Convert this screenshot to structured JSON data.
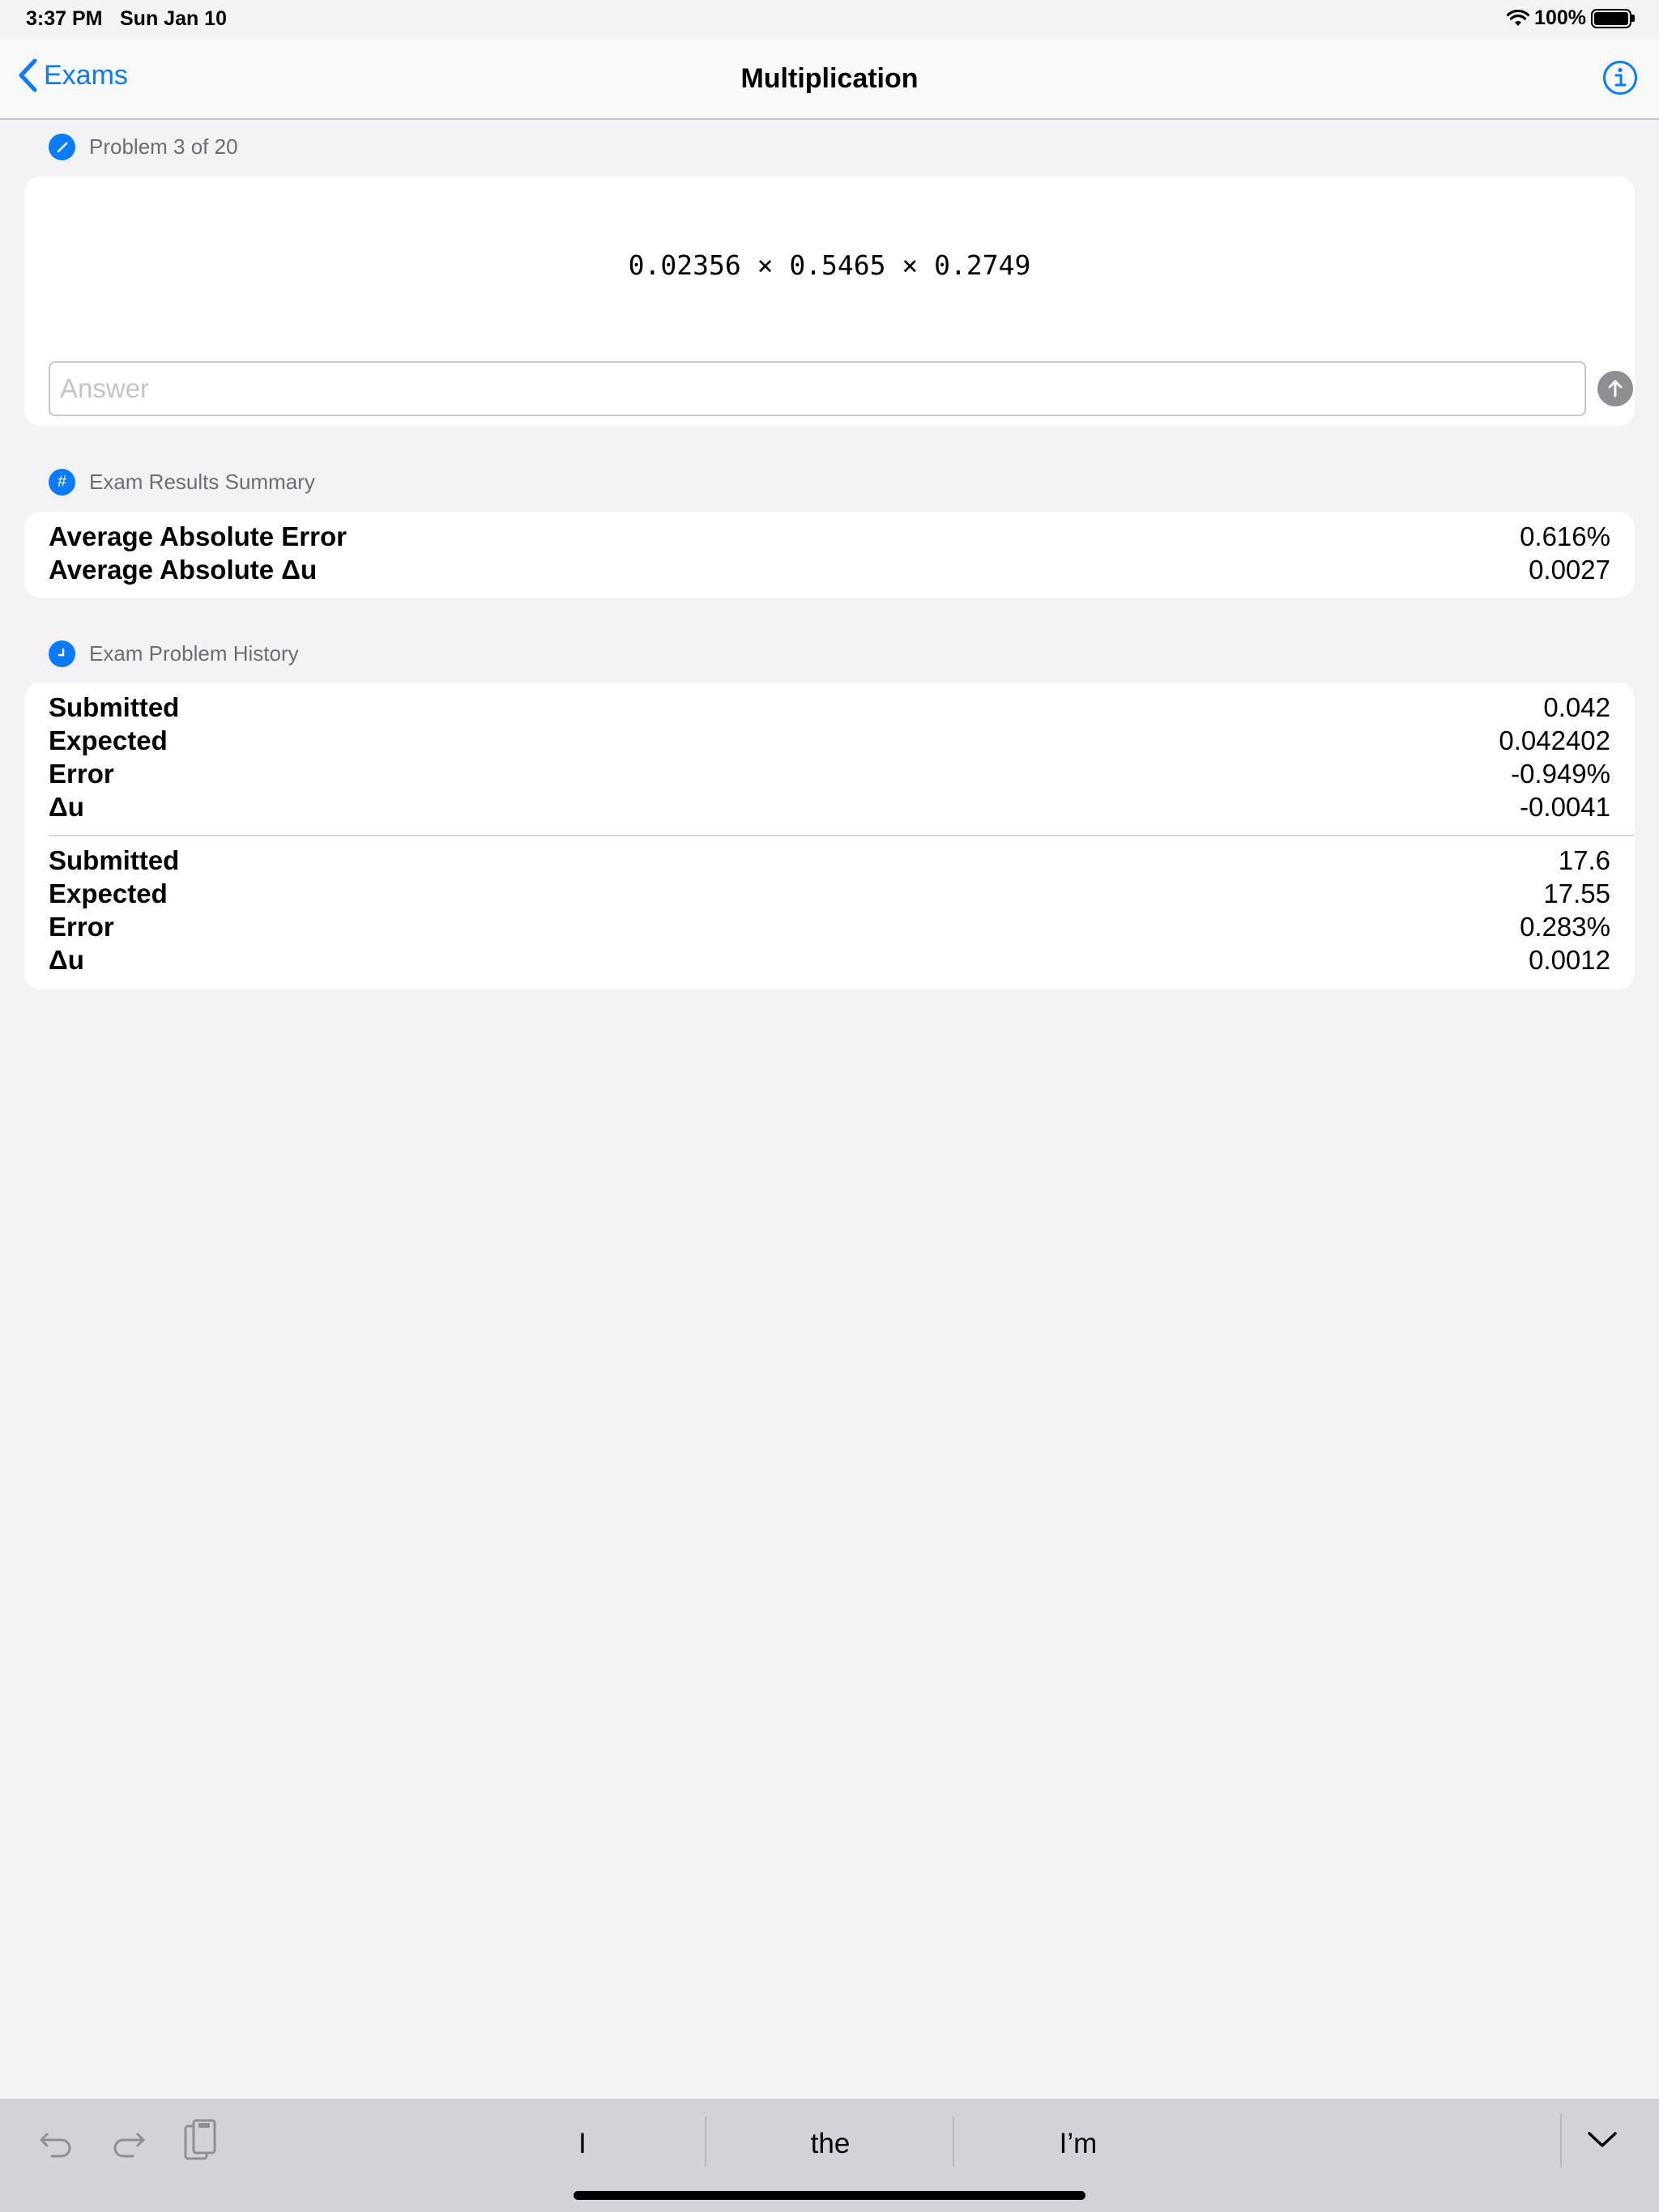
{
  "status_bar": {
    "time": "3:37 PM",
    "date": "Sun Jan 10",
    "battery": "100%"
  },
  "nav": {
    "back_label": "Exams",
    "title": "Multiplication"
  },
  "problem_section": {
    "header": "Problem 3 of 20",
    "expression": "0.02356 × 0.5465 × 0.2749",
    "answer_placeholder": "Answer",
    "answer_value": ""
  },
  "summary_section": {
    "header": "Exam Results Summary",
    "rows": [
      {
        "label": "Average Absolute Error",
        "value": "0.616%"
      },
      {
        "label": "Average Absolute Δu",
        "value": "0.0027"
      }
    ]
  },
  "history_section": {
    "header": "Exam Problem History",
    "entries": [
      {
        "submitted_label": "Submitted",
        "submitted": "0.042",
        "expected_label": "Expected",
        "expected": "0.042402",
        "error_label": "Error",
        "error": "-0.949%",
        "delta_label": "Δu",
        "delta": "-0.0041"
      },
      {
        "submitted_label": "Submitted",
        "submitted": "17.6",
        "expected_label": "Expected",
        "expected": "17.55",
        "error_label": "Error",
        "error": "0.283%",
        "delta_label": "Δu",
        "delta": "0.0012"
      }
    ]
  },
  "keyboard_bar": {
    "suggestions": [
      "I",
      "the",
      "I’m"
    ]
  },
  "colors": {
    "accent": "#0a7aff",
    "background": "#f2f2f7",
    "card": "#ffffff",
    "secondary_text": "#6d6d72"
  },
  "icons": [
    "wifi-icon",
    "battery-icon",
    "chevron-left-icon",
    "info-icon",
    "pencil-icon",
    "hash-icon",
    "clock-icon",
    "arrow-up-icon",
    "undo-icon",
    "redo-icon",
    "paste-icon",
    "chevron-down-icon"
  ]
}
